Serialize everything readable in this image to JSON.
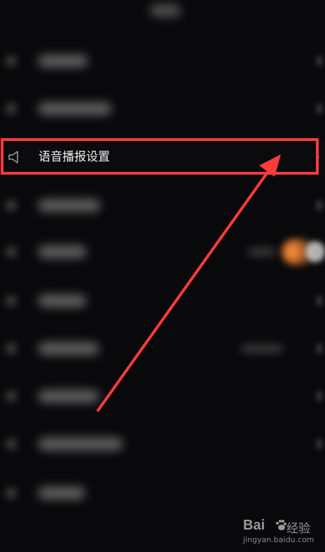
{
  "focused_item": {
    "label": "语音播报设置",
    "icon": "speaker-icon",
    "chevron": "›"
  },
  "blurred_rows": [
    {
      "id": "row-1"
    },
    {
      "id": "row-2"
    },
    {
      "id": "row-4"
    },
    {
      "id": "row-5"
    },
    {
      "id": "row-6"
    },
    {
      "id": "row-7"
    },
    {
      "id": "row-8"
    },
    {
      "id": "row-9"
    },
    {
      "id": "row-10"
    }
  ],
  "annotation": {
    "highlight_color": "#ff3b3b",
    "arrow_color": "#ff3b3b"
  },
  "watermark": {
    "brand": "Bai",
    "brand_suffix": "经验",
    "url": "jingyan.baidu.com"
  },
  "colors": {
    "background": "#09090b",
    "toggle_accent": "#ff9a3c"
  }
}
